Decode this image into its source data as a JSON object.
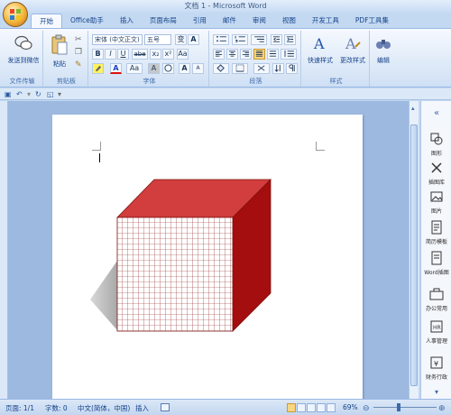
{
  "window": {
    "title": "文档 1 - Microsoft Word"
  },
  "tabs": [
    "开始",
    "Office助手",
    "插入",
    "页面布局",
    "引用",
    "邮件",
    "审阅",
    "视图",
    "开发工具",
    "PDF工具集"
  ],
  "ribbon": {
    "groups": {
      "wechat": {
        "button": "发送到微信",
        "label": "文件传输"
      },
      "clipboard": {
        "paste": "粘贴",
        "label": "剪贴板"
      },
      "font": {
        "font_name": "宋体 (中文正文)",
        "font_size": "五号",
        "label": "字体"
      },
      "paragraph": {
        "label": "段落"
      },
      "styles": {
        "quick": "快速样式",
        "change": "更改样式",
        "label": "样式"
      },
      "editing": {
        "button": "编辑"
      }
    },
    "font_buttons": {
      "bold": "B",
      "italic": "I",
      "underline": "U",
      "strike": "abe",
      "sub": "x₂",
      "sup": "x²",
      "font_color": "A",
      "grow": "A",
      "shrink": "A",
      "clear": "Aa",
      "char_border": "A",
      "char_shade": "A",
      "phonetic": "变"
    }
  },
  "right_panel": [
    "图形",
    "插图库",
    "图片",
    "简历模板",
    "Word插图",
    "办公常用",
    "人事管理",
    "财务行政"
  ],
  "status": {
    "page": "页面: 1/1",
    "words": "字数: 0",
    "language": "中文(简体，中国)",
    "insert_mode": "插入",
    "zoom": "69%"
  },
  "colors": {
    "cube_top": "#d23d3d",
    "cube_side": "#a50e0e",
    "cube_grid": "#8a1c1c",
    "ribbon_bg": "#dbe8f7"
  }
}
